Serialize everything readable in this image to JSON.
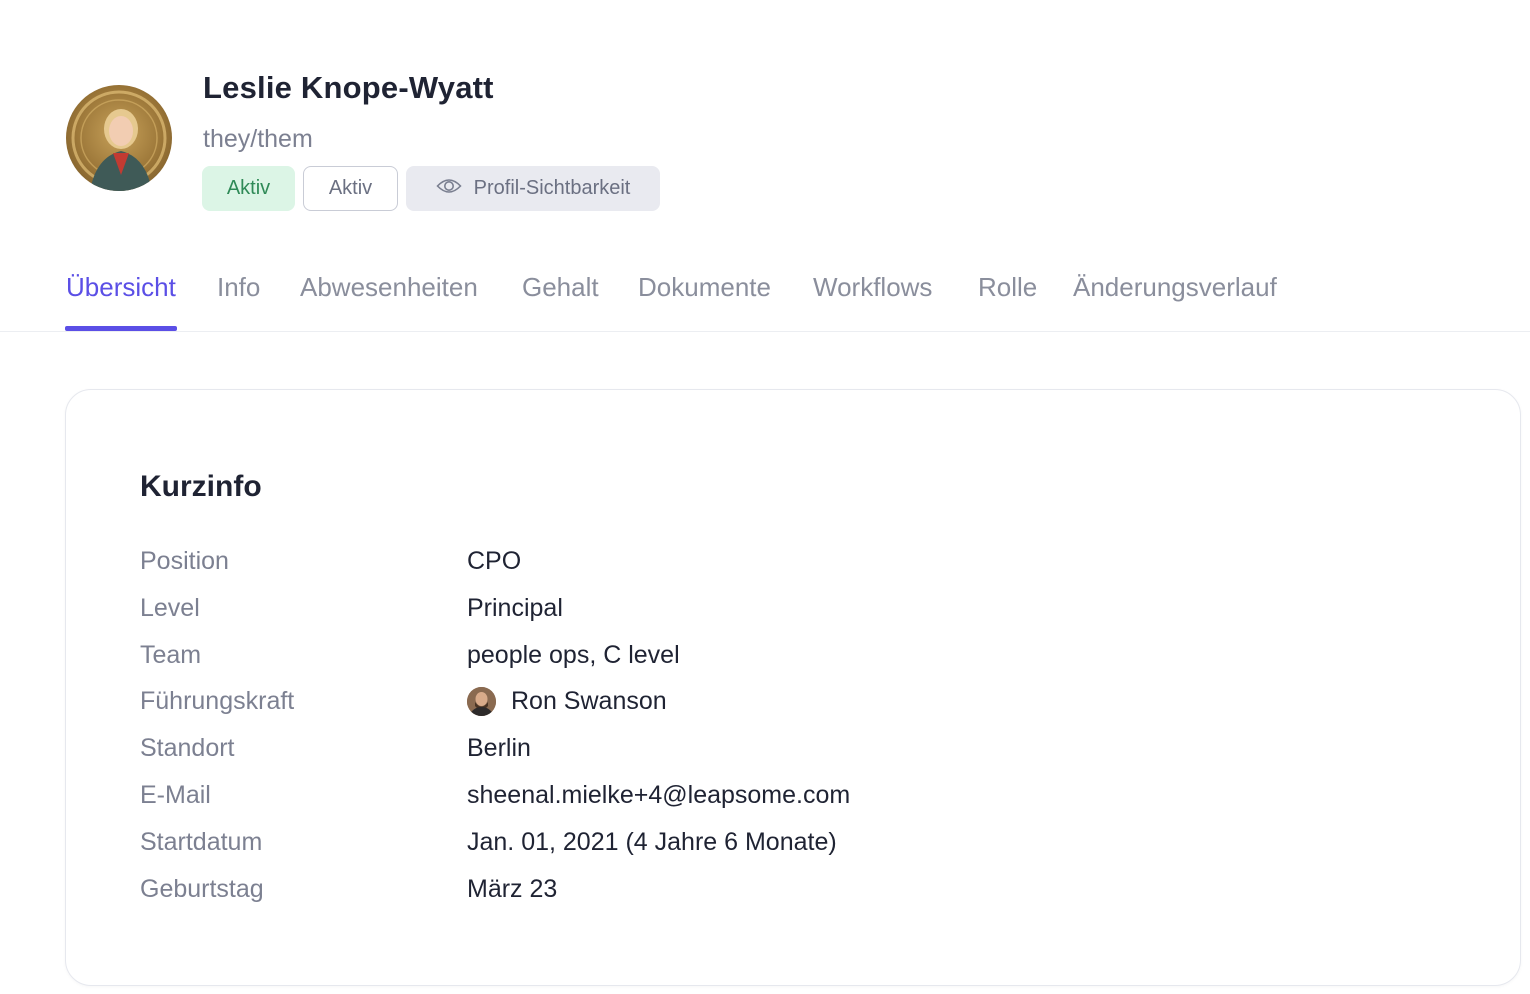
{
  "profile": {
    "name": "Leslie Knope-Wyatt",
    "pronouns": "they/them",
    "badges": {
      "status": "Aktiv",
      "status_outline": "Aktiv",
      "visibility": "Profil-Sichtbarkeit"
    },
    "avatar_icon": "profile-photo",
    "colors": {
      "status_bg": "#dcf5e6",
      "status_text": "#2f8a57",
      "accent": "#5b4fe6"
    }
  },
  "tabs": [
    {
      "label": "Übersicht",
      "active": true
    },
    {
      "label": "Info",
      "active": false
    },
    {
      "label": "Abwesenheiten",
      "active": false
    },
    {
      "label": "Gehalt",
      "active": false
    },
    {
      "label": "Dokumente",
      "active": false
    },
    {
      "label": "Workflows",
      "active": false
    },
    {
      "label": "Rolle",
      "active": false
    },
    {
      "label": "Änderungsverlauf",
      "active": false
    }
  ],
  "card": {
    "title": "Kurzinfo",
    "rows": [
      {
        "label": "Position",
        "value": "CPO"
      },
      {
        "label": "Level",
        "value": "Principal"
      },
      {
        "label": "Team",
        "value": "people ops, C level"
      },
      {
        "label": "Führungskraft",
        "value": "Ron Swanson"
      },
      {
        "label": "Standort",
        "value": "Berlin"
      },
      {
        "label": "E-Mail",
        "value": "sheenal.mielke+4@leapsome.com"
      },
      {
        "label": "Startdatum",
        "value": "Jan. 01, 2021 (4 Jahre 6 Monate)"
      },
      {
        "label": "Geburtstag",
        "value": "März 23"
      }
    ]
  }
}
